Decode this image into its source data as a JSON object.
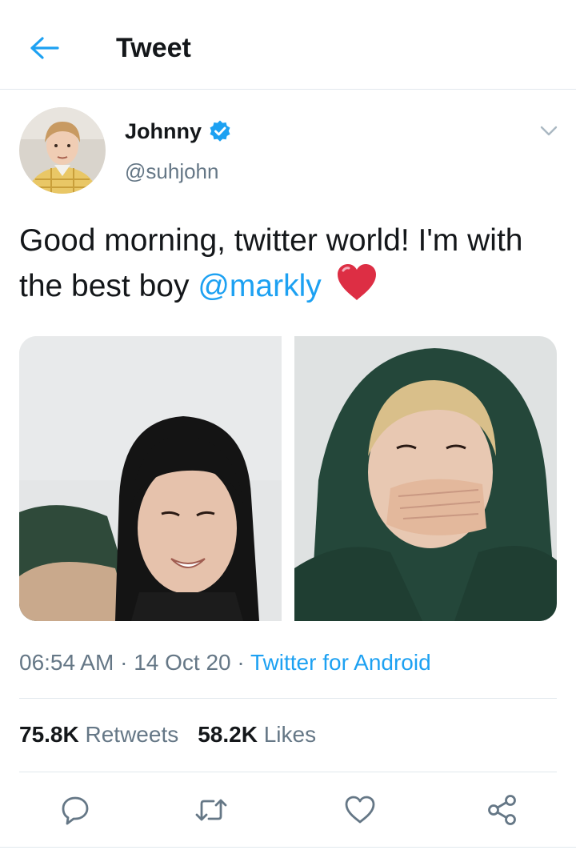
{
  "header": {
    "title": "Tweet",
    "back_icon": "arrow-left-icon"
  },
  "tweet": {
    "author": {
      "name": "Johnny",
      "handle": "@suhjohn",
      "verified": true
    },
    "text_parts": [
      "Good morning, twitter world! I'm with the best boy ",
      "@markly",
      " "
    ],
    "emoji": "red-heart-icon",
    "media_count": 2,
    "time": "06:54 AM",
    "separator": "·",
    "date": "14 Oct 20",
    "source": "Twitter for Android",
    "stats": {
      "retweets_count": "75.8K",
      "retweets_label": "Retweets",
      "likes_count": "58.2K",
      "likes_label": "Likes"
    }
  },
  "actions": [
    "reply-icon",
    "retweet-icon",
    "like-icon",
    "share-icon"
  ],
  "colors": {
    "accent": "#1da1f2",
    "text": "#14171a",
    "secondary": "#657786",
    "border": "#e1e8ed",
    "heart": "#e0245e"
  }
}
